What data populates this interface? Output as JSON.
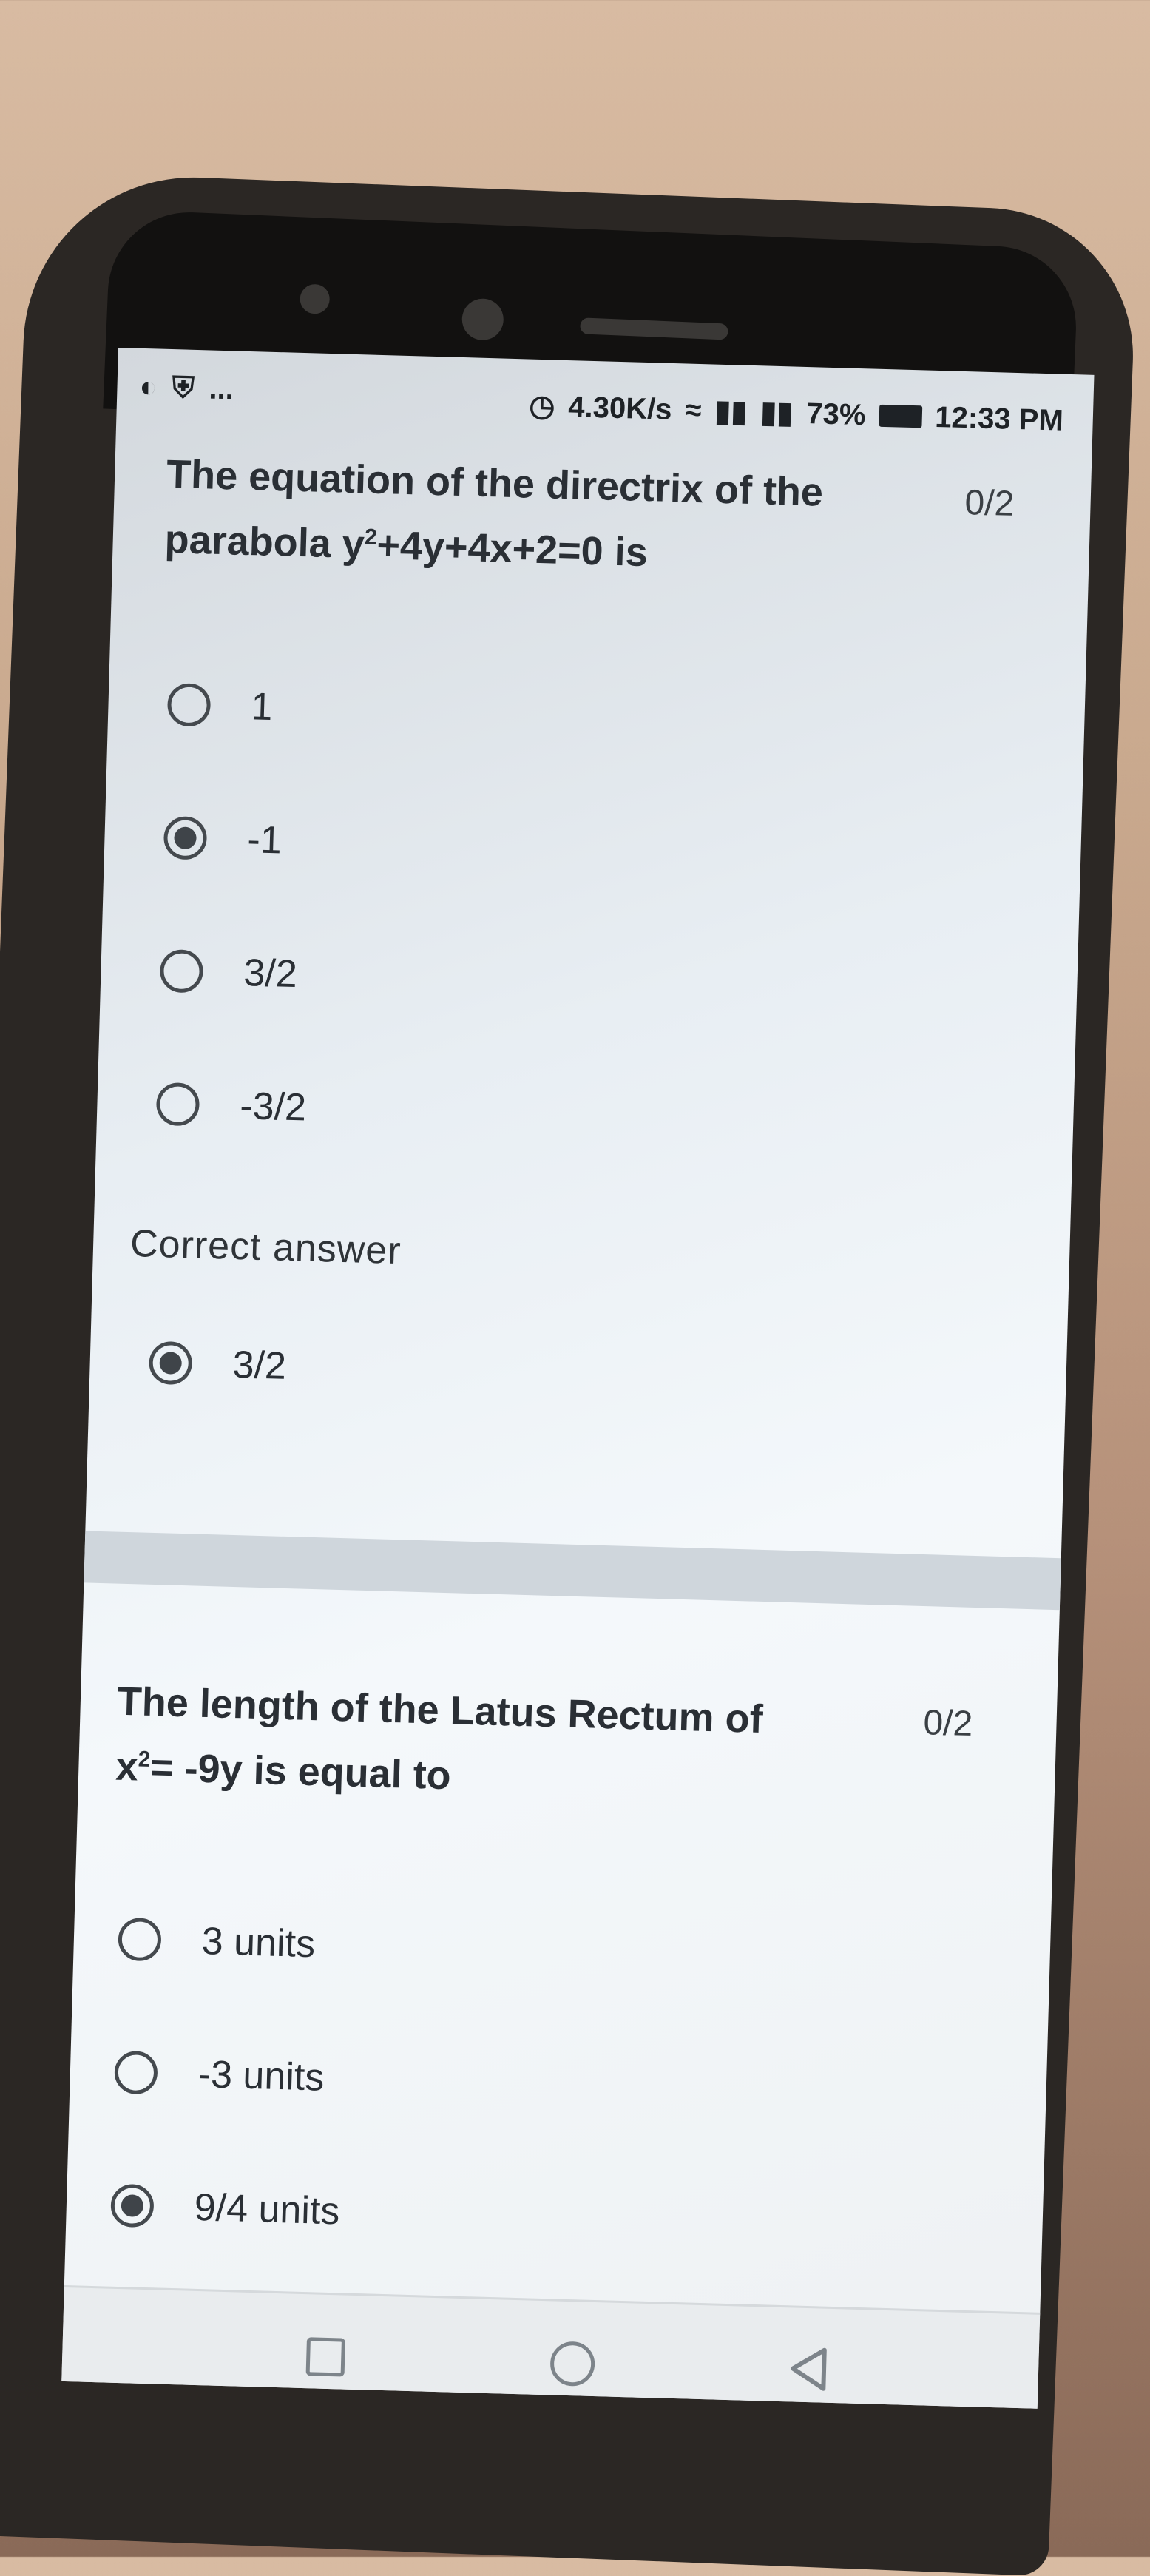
{
  "status_bar": {
    "net_speed": "4.30K/s",
    "battery": "73%",
    "time": "12:33 PM",
    "more": "...",
    "icons": [
      "chat-icon",
      "shield-icon",
      "clock-icon",
      "wifi-icon",
      "signal-icon",
      "signal-icon",
      "battery-icon"
    ]
  },
  "question1": {
    "text_line1": "The equation of the directrix of the",
    "text_line2_prefix": "parabola y",
    "text_line2_sup": "2",
    "text_line2_suffix": "+4y+4x+2=0 is",
    "score": "0/2",
    "options": [
      {
        "label": "1",
        "selected": false
      },
      {
        "label": "-1",
        "selected": true
      },
      {
        "label": "3/2",
        "selected": false
      },
      {
        "label": "-3/2",
        "selected": false
      }
    ],
    "correct_answer_label": "Correct answer",
    "correct_answer": "3/2"
  },
  "question2": {
    "text_line1": "The length of the Latus Rectum of",
    "text_line2_prefix": "x",
    "text_line2_sup": "2",
    "text_line2_suffix": "= -9y is equal to",
    "score": "0/2",
    "options": [
      {
        "label": "3 units",
        "selected": false
      },
      {
        "label": "-3 units",
        "selected": false
      },
      {
        "label": "9/4 units",
        "selected": true
      }
    ]
  },
  "nav": {
    "icons": [
      "recent-apps-icon",
      "home-icon",
      "back-icon"
    ]
  }
}
